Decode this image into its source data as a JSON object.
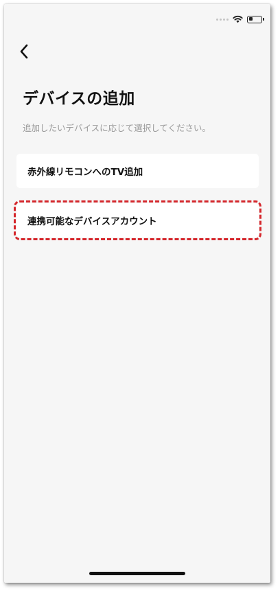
{
  "status_bar": {
    "wifi_icon": "wifi-icon",
    "battery_icon": "battery-icon",
    "battery_level": 0.3
  },
  "nav": {
    "back_icon": "chevron-left-icon"
  },
  "header": {
    "title": "デバイスの追加",
    "subtitle": "追加したいデバイスに応じて選択してください。"
  },
  "options": [
    {
      "label": "赤外線リモコンへのTV追加"
    },
    {
      "label": "連携可能なデバイスアカウント",
      "highlighted": true
    }
  ],
  "colors": {
    "background": "#f6f6f6",
    "card": "#ffffff",
    "highlight": "#d5262b",
    "title": "#111111",
    "subtitle": "#9a9a9a"
  }
}
